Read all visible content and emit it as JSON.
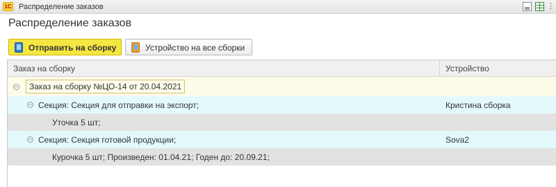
{
  "window": {
    "title": "Распределение заказов",
    "logo_text": "1С",
    "toolbar_icons": [
      "print-icon",
      "table-icon",
      "more-icon"
    ]
  },
  "form": {
    "title": "Распределение заказов"
  },
  "actions": {
    "send_label": "Отправить на сборку",
    "device_label": "Устройство на все сборки"
  },
  "grid": {
    "columns": [
      "Заказ на сборку",
      "Устройство"
    ],
    "rows": [
      {
        "level": 0,
        "text": "Заказ на сборку №ЦО-14 от 20.04.2021",
        "device": ""
      },
      {
        "level": 1,
        "text": "Секция: Секция для отправки на экспорт;",
        "device": "Кристина сборка"
      },
      {
        "level": 2,
        "text": "Уточка 5 шт;",
        "device": ""
      },
      {
        "level": 1,
        "text": "Секция: Секция готовой продукции;",
        "device": "Sova2"
      },
      {
        "level": 2,
        "text": "Курочка 5 шт; Произведен: 01.04.21; Годен до: 20.09.21;",
        "device": ""
      }
    ]
  },
  "colors": {
    "accent_button": "#f5e642",
    "section_row": "#e4f9fb",
    "item_row": "#e2e2e2",
    "order_row": "#fdfbe9"
  }
}
